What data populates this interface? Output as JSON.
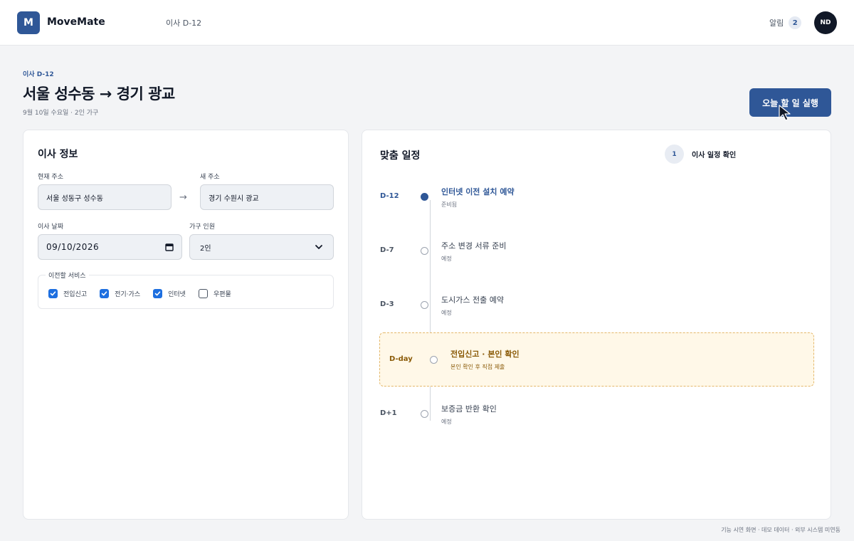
{
  "header": {
    "logo_letter": "M",
    "app_name": "MoveMate",
    "dday": "이사 D-12",
    "notif_label": "알림",
    "notif_count": "2",
    "avatar": "ND"
  },
  "page": {
    "eyebrow": "이사 D-12",
    "title": "서울 성수동 → 경기 광교",
    "subtitle": "9월 10일 수요일 · 2인 가구",
    "run_button": "오늘 할 일 실행"
  },
  "info": {
    "title": "이사 정보",
    "current_label": "현재 주소",
    "current_value": "서울 성동구 성수동",
    "new_label": "새 주소",
    "new_value": "경기 수원시 광교",
    "date_label": "이사 날짜",
    "date_value": "09/10/2026",
    "household_label": "가구 인원",
    "household_value": "2인",
    "services_legend": "이전할 서비스",
    "services": [
      {
        "label": "전입신고",
        "checked": true
      },
      {
        "label": "전기·가스",
        "checked": true
      },
      {
        "label": "인터넷",
        "checked": true
      },
      {
        "label": "우편물",
        "checked": false
      }
    ]
  },
  "schedule": {
    "title": "맞춤 일정",
    "step_number": "1",
    "step_label": "이사 일정 확인",
    "items": [
      {
        "day": "D-12",
        "title": "인터넷 이전 설치 예약",
        "status": "준비됨"
      },
      {
        "day": "D-7",
        "title": "주소 변경 서류 준비",
        "status": "예정"
      },
      {
        "day": "D-3",
        "title": "도시가스 전출 예약",
        "status": "예정"
      },
      {
        "day": "D-day",
        "title": "전입신고 · 본인 확인",
        "status": "본인 확인 후 직접 제출"
      },
      {
        "day": "D+1",
        "title": "보증금 반환 확인",
        "status": "예정"
      }
    ]
  },
  "footer": {
    "note": "기능 시연 화면 · 데모 데이터 · 외부 시스템 미연동"
  },
  "colors": {
    "brand": "#2f5797",
    "highlight_bg": "#fff8e8",
    "highlight_text": "#8a5a07"
  }
}
